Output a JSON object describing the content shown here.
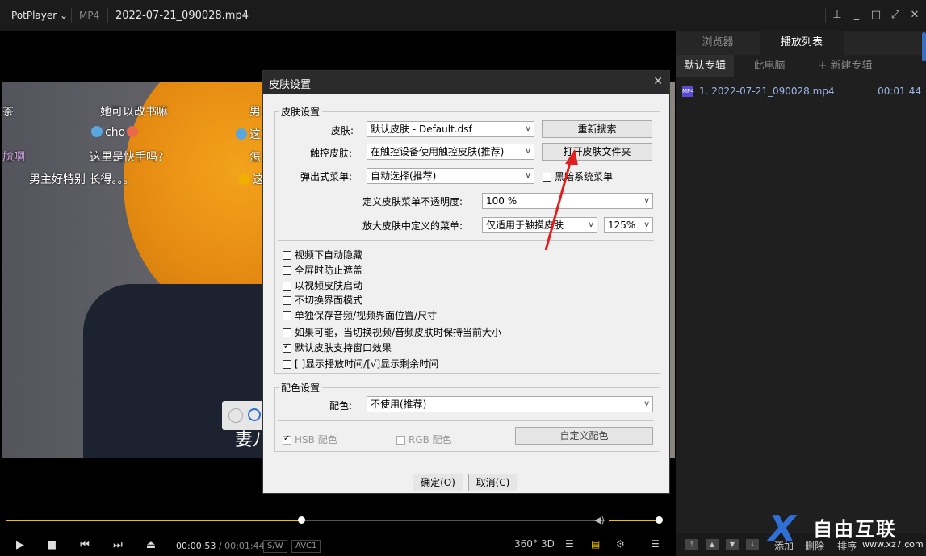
{
  "titlebar": {
    "app": "PotPlayer",
    "format": "MP4",
    "filename": "2022-07-21_090028.mp4"
  },
  "danmu": {
    "l1a": "茶",
    "l1b": "她可以改书嘛",
    "l1c": "男",
    "l2a": "cho",
    "l2b": "这",
    "l3a": "尬啊",
    "l3b": "这里是快手吗?",
    "l3c": "怎",
    "l4a": "男主好特别 长得。。。",
    "l4b": "这"
  },
  "video": {
    "subtitle": "妻八"
  },
  "playback": {
    "current": "00:00:53",
    "separator": "/",
    "total": "00:01:44",
    "sw": "S/W",
    "codec": "AVC1",
    "progress": 0.492,
    "volume": 1.0
  },
  "right_panel": {
    "tabs": [
      "浏览器",
      "播放列表"
    ],
    "subtabs": [
      "默认专辑",
      "此电脑",
      "+ 新建专辑"
    ],
    "items": [
      {
        "name": "1. 2022-07-21_090028.mp4",
        "duration": "00:01:44"
      }
    ],
    "bottom": {
      "add": "添加",
      "delete": "删除",
      "sort": "排序"
    }
  },
  "dialog": {
    "title": "皮肤设置",
    "skin_group": "皮肤设置",
    "skin_label": "皮肤:",
    "skin_value": "默认皮肤 - Default.dsf",
    "research_button": "重新搜索",
    "touch_label": "触控皮肤:",
    "touch_value": "在触控设备使用触控皮肤(推荐)",
    "open_folder_button": "打开皮肤文件夹",
    "popup_label": "弹出式菜单:",
    "popup_value": "自动选择(推荐)",
    "black_menu": "黑暗系统菜单",
    "opacity_label": "定义皮肤菜单不透明度:",
    "opacity_value": "100 %",
    "zoom_label": "放大皮肤中定义的菜单:",
    "zoom_value": "仅适用于触摸皮肤",
    "zoom_pct": "125%",
    "options": [
      {
        "label": "视频下自动隐藏",
        "checked": false
      },
      {
        "label": "全屏时防止遮盖",
        "checked": false
      },
      {
        "label": "以视频皮肤启动",
        "checked": false
      },
      {
        "label": "不切换界面模式",
        "checked": false
      },
      {
        "label": "单独保存音频/视频界面位置/尺寸",
        "checked": false
      },
      {
        "label": "如果可能，当切换视频/音频皮肤时保持当前大小",
        "checked": false
      },
      {
        "label": "默认皮肤支持窗口效果",
        "checked": true
      },
      {
        "label": "[ ]显示播放时间/[√]显示剩余时间",
        "checked": false
      }
    ],
    "color_group": "配色设置",
    "color_label": "配色:",
    "color_value": "不使用(推荐)",
    "hsb": "HSB 配色",
    "rgb": "RGB 配色",
    "custom_color_button": "自定义配色",
    "ok": "确定(O)",
    "cancel": "取消(C)"
  },
  "watermark": {
    "text": "自由互联",
    "url": "www.xz7.com"
  },
  "colors": {
    "accent": "#f0c000",
    "annotation_arrow": "#e02020",
    "dialog_bg": "#f0f0f0"
  }
}
